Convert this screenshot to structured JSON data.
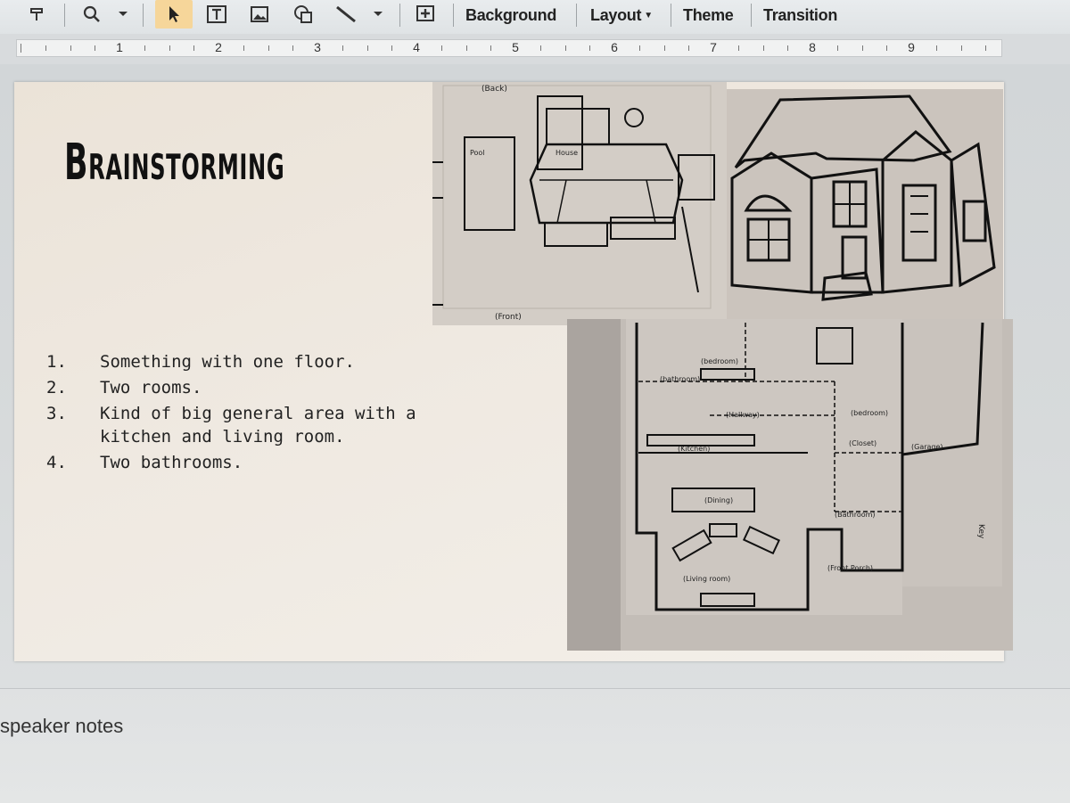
{
  "toolbar": {
    "icons": [
      "format-icon",
      "zoom-icon",
      "zoom-caret-icon",
      "select-icon",
      "text-box-icon",
      "image-icon",
      "shape-icon",
      "line-icon",
      "line-caret-icon",
      "new-comment-icon"
    ],
    "background_label": "Background",
    "layout_label": "Layout",
    "theme_label": "Theme",
    "transition_label": "Transition"
  },
  "ruler": {
    "numbers": [
      "1",
      "2",
      "3",
      "4",
      "5",
      "6",
      "7",
      "8",
      "9"
    ]
  },
  "slide": {
    "title": "Brainstorming",
    "list": [
      {
        "num": "1.",
        "text": "Something with one floor."
      },
      {
        "num": "2.",
        "text": "Two rooms."
      },
      {
        "num": "3.",
        "text": "Kind of big general area with a kitchen and living room."
      },
      {
        "num": "4.",
        "text": "Two bathrooms."
      }
    ],
    "site_plan": {
      "labels": {
        "back": "(Back)",
        "pool": "Pool",
        "house": "House",
        "front": "(Front)"
      }
    },
    "floor_plan": {
      "labels": {
        "bedroom_1": "(bedroom)",
        "bathroom_1": "(bathroom)",
        "hallway": "(Hallway)",
        "bedroom_2": "(bedroom)",
        "kitchen": "(Kitchen)",
        "closet": "(Closet)",
        "garage": "(Garage)",
        "dining": "(Dining)",
        "bathroom_2": "(Bathroom)",
        "living_room": "(Living room)",
        "front_porch": "(Front Porch)",
        "key": "Key"
      }
    }
  },
  "notes": {
    "label": "speaker notes"
  },
  "colors": {
    "toolbar_bg": "#e4e7e9",
    "slide_bg": "#efe9e1",
    "active_tool": "#f6d69a",
    "ink": "#111111"
  }
}
